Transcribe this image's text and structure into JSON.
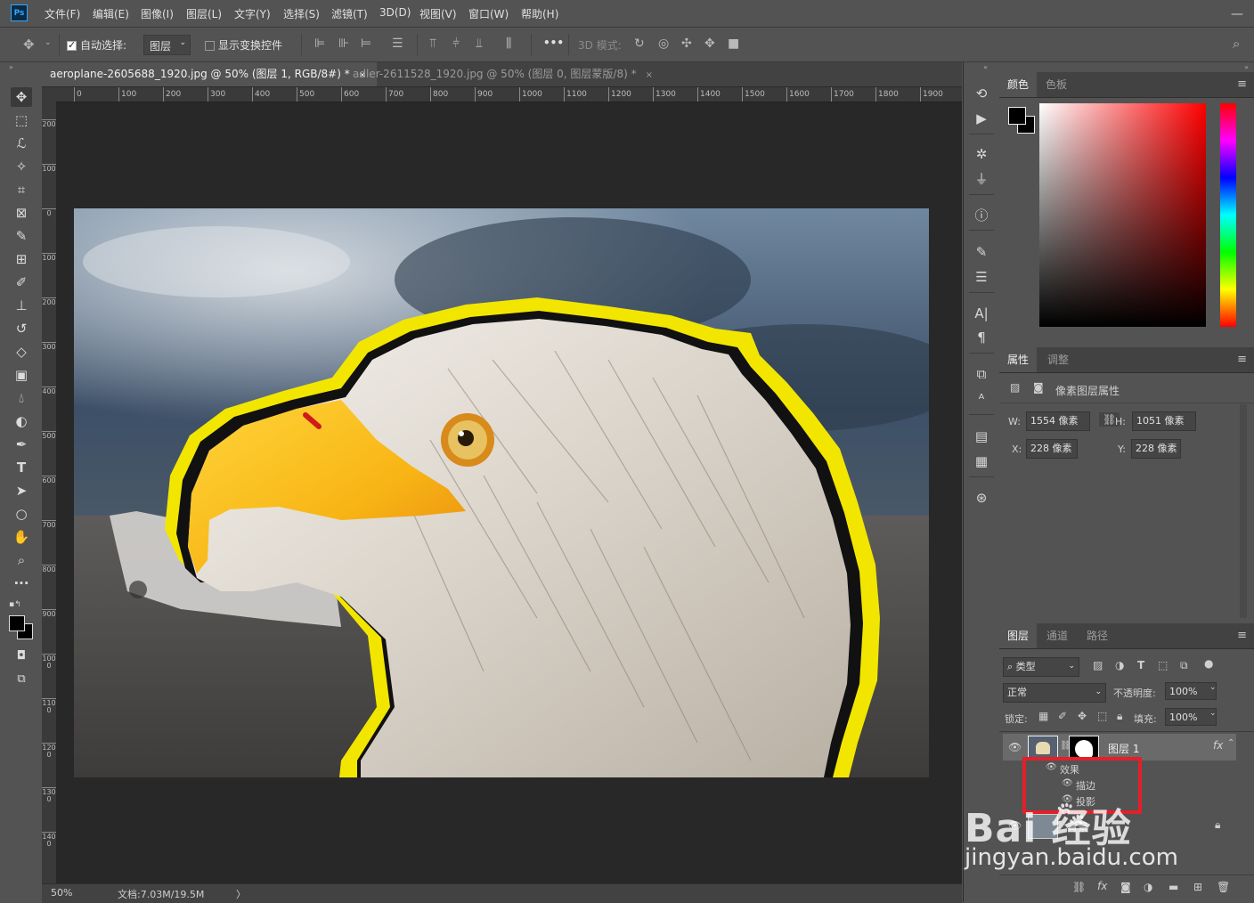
{
  "app": {
    "logo": "Ps",
    "menu": [
      "文件(F)",
      "编辑(E)",
      "图像(I)",
      "图层(L)",
      "文字(Y)",
      "选择(S)",
      "滤镜(T)",
      "3D(D)",
      "视图(V)",
      "窗口(W)",
      "帮助(H)"
    ],
    "window_controls": "—"
  },
  "options": {
    "auto_select_label": "自动选择:",
    "auto_select_value": "图层",
    "show_transform_label": "显示变换控件",
    "mode_3d_label": "3D 模式:",
    "more": "•••"
  },
  "tabs": [
    {
      "label": "aeroplane-2605688_1920.jpg @ 50% (图层 1, RGB/8#) *",
      "close": "×"
    },
    {
      "label": "adler-2611528_1920.jpg @ 50% (图层 0, 图层蒙版/8) *",
      "close": "×"
    }
  ],
  "ruler": {
    "h_ticks": [
      "0",
      "100",
      "200",
      "300",
      "400",
      "500",
      "600",
      "700",
      "800",
      "900",
      "1000",
      "1100",
      "1200",
      "1300",
      "1400",
      "1500",
      "1600",
      "1700",
      "1800",
      "1900"
    ],
    "v_ticks": [
      "200",
      "100",
      "0",
      "100",
      "200",
      "300",
      "400",
      "500",
      "600",
      "700",
      "800",
      "900",
      "1000",
      "1100",
      "1200",
      "1300",
      "1400"
    ]
  },
  "status": {
    "zoom": "50%",
    "doc": "文档:7.03M/19.5M",
    "arrow": "〉"
  },
  "color_panel": {
    "tabs": [
      "颜色",
      "色板"
    ],
    "menu": "≡"
  },
  "properties_panel": {
    "tabs": [
      "属性",
      "调整"
    ],
    "title": "像素图层属性",
    "w_label": "W:",
    "w_value": "1554 像素",
    "h_label": "H:",
    "h_value": "1051 像素",
    "x_label": "X:",
    "x_value": "228 像素",
    "y_label": "Y:",
    "y_value": "228 像素"
  },
  "layers_panel": {
    "tabs": [
      "图层",
      "通道",
      "路径"
    ],
    "filter_kind": "类型",
    "blend_mode": "正常",
    "opacity_label": "不透明度:",
    "opacity_value": "100%",
    "lock_label": "锁定:",
    "fill_label": "填充:",
    "fill_value": "100%",
    "layers": [
      {
        "name": "图层 1",
        "fx": "fx"
      },
      {
        "name": "背景"
      }
    ],
    "effects_label": "效果",
    "effects": [
      "描边",
      "投影"
    ],
    "bottom_icons": [
      "link-icon",
      "fx",
      "mask-icon",
      "adjustment-icon",
      "folder-icon",
      "new-layer-icon",
      "trash-icon"
    ],
    "fx_bottom": "fx"
  },
  "watermark": {
    "brand": "Bai  经验",
    "url": "jingyan.baidu.com"
  },
  "colors": {
    "stroke_yellow": "#f2e600",
    "highlight_red": "#e3202a",
    "ps_blue": "#31a8ff"
  }
}
